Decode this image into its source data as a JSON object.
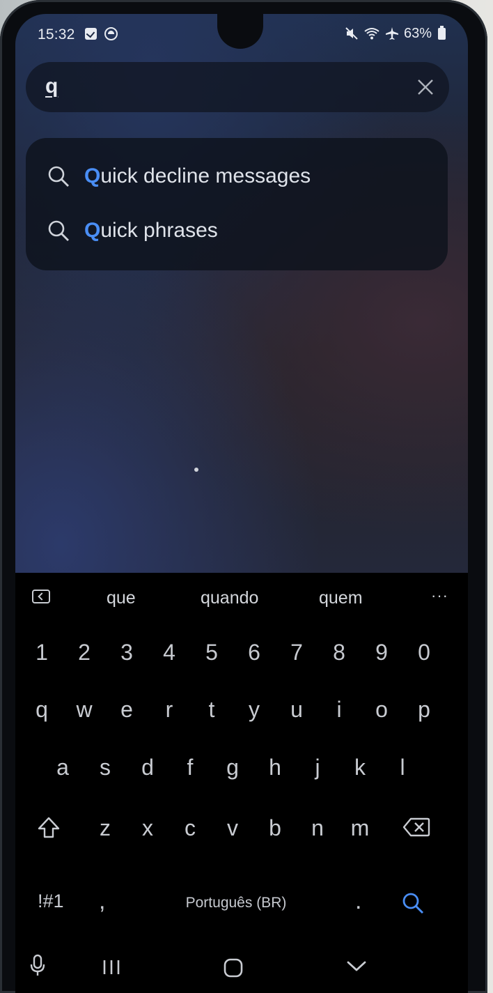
{
  "status": {
    "time": "15:32",
    "battery": "63%"
  },
  "search": {
    "query": "q"
  },
  "suggestions": [
    {
      "match": "Q",
      "rest": "uick decline messages"
    },
    {
      "match": "Q",
      "rest": "uick phrases"
    }
  ],
  "keyboard": {
    "predictions": [
      "que",
      "quando",
      "quem"
    ],
    "more": "···",
    "numbers": [
      "1",
      "2",
      "3",
      "4",
      "5",
      "6",
      "7",
      "8",
      "9",
      "0"
    ],
    "row1": [
      "q",
      "w",
      "e",
      "r",
      "t",
      "y",
      "u",
      "i",
      "o",
      "p"
    ],
    "row2": [
      "a",
      "s",
      "d",
      "f",
      "g",
      "h",
      "j",
      "k",
      "l"
    ],
    "row3": [
      "z",
      "x",
      "c",
      "v",
      "b",
      "n",
      "m"
    ],
    "symbols_label": "!#1",
    "comma": ",",
    "period": ".",
    "space_label": "Português (BR)"
  },
  "colors": {
    "accent": "#4a8ef5"
  }
}
